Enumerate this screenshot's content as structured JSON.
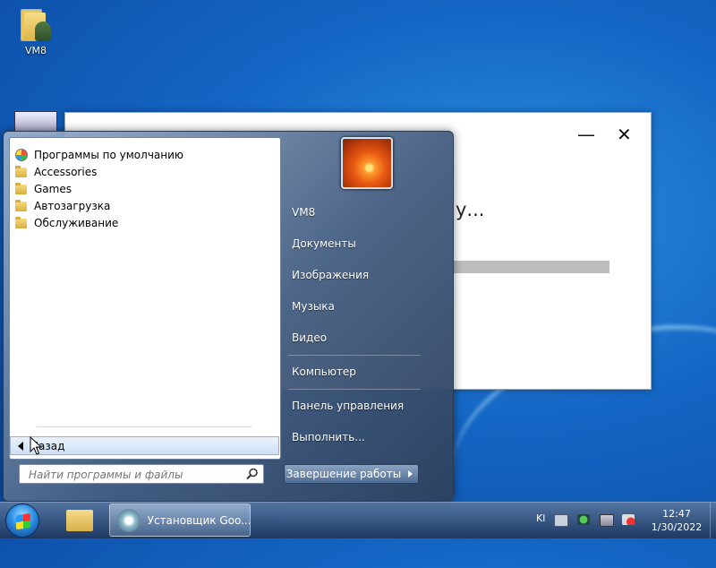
{
  "desktop": {
    "icon_label": "VM8"
  },
  "installer": {
    "status_text": "у...",
    "minimize_symbol": "—",
    "close_symbol": "✕"
  },
  "start_menu": {
    "programs": [
      {
        "label": "Программы по умолчанию",
        "icon": "default-programs-icon"
      },
      {
        "label": "Accessories",
        "icon": "folder-icon"
      },
      {
        "label": "Games",
        "icon": "folder-icon"
      },
      {
        "label": "Автозагрузка",
        "icon": "folder-icon"
      },
      {
        "label": "Обслуживание",
        "icon": "folder-icon"
      }
    ],
    "back_label": "Назад",
    "search_placeholder": "Найти программы и файлы",
    "right_items": {
      "user": "VM8",
      "documents": "Документы",
      "pictures": "Изображения",
      "music": "Музыка",
      "video": "Видео",
      "computer": "Компьютер",
      "control_panel": "Панель управления",
      "run": "Выполнить..."
    },
    "shutdown_label": "Завершение работы"
  },
  "taskbar": {
    "app_label": "Установщик Goo...",
    "language": "Kl",
    "time": "12:47",
    "date": "1/30/2022"
  },
  "colors": {
    "desktop": "#1466c4",
    "accent": "#cfe1f6"
  }
}
